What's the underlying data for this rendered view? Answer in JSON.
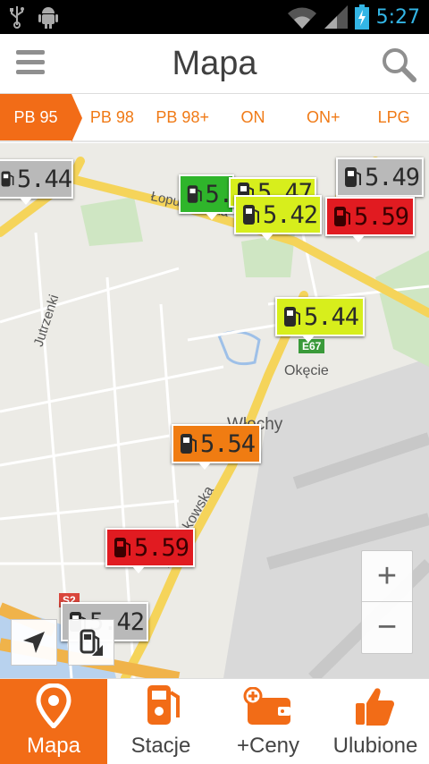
{
  "status_bar": {
    "time": "5:27"
  },
  "app_bar": {
    "title": "Mapa"
  },
  "fuel_tabs": [
    {
      "label": "PB 95",
      "active": true
    },
    {
      "label": "PB 98"
    },
    {
      "label": "PB 98+"
    },
    {
      "label": "ON"
    },
    {
      "label": "ON+"
    },
    {
      "label": "LPG"
    }
  ],
  "map": {
    "labels": {
      "street_lopuszanska": "Łopuszańska",
      "street_jutrzenki": "Jutrzenki",
      "district_okecie": "Okęcie",
      "district_wlochy": "Włochy",
      "street_al_krakowska": "Al. Krakowska",
      "road_e67": "E67",
      "road_s2": "S2"
    },
    "markers": [
      {
        "price": "5.44",
        "color": "gray"
      },
      {
        "price": "5.",
        "color": "green"
      },
      {
        "price": "5.47",
        "color": "yellow"
      },
      {
        "price": "5.42",
        "color": "yellow"
      },
      {
        "price": "5.49",
        "color": "gray"
      },
      {
        "price": "5.59",
        "color": "red"
      },
      {
        "price": "5.44",
        "color": "yellow"
      },
      {
        "price": "5.54",
        "color": "orange"
      },
      {
        "price": "5.59",
        "color": "red"
      },
      {
        "price": "5.42",
        "color": "gray"
      }
    ],
    "zoom_in": "+",
    "zoom_out": "−"
  },
  "bottom_nav": [
    {
      "label": "Mapa",
      "icon": "map-pin-icon",
      "active": true
    },
    {
      "label": "Stacje",
      "icon": "fuel-pump-icon"
    },
    {
      "label": "+Ceny",
      "icon": "wallet-add-icon"
    },
    {
      "label": "Ulubione",
      "icon": "thumbs-up-icon"
    }
  ],
  "colors": {
    "accent": "#f26c17",
    "marker_gray": "#b9b9b9",
    "marker_yellow": "#d7ee1c",
    "marker_red": "#e11b21",
    "marker_green": "#2fb52b",
    "marker_orange": "#f07c12"
  }
}
